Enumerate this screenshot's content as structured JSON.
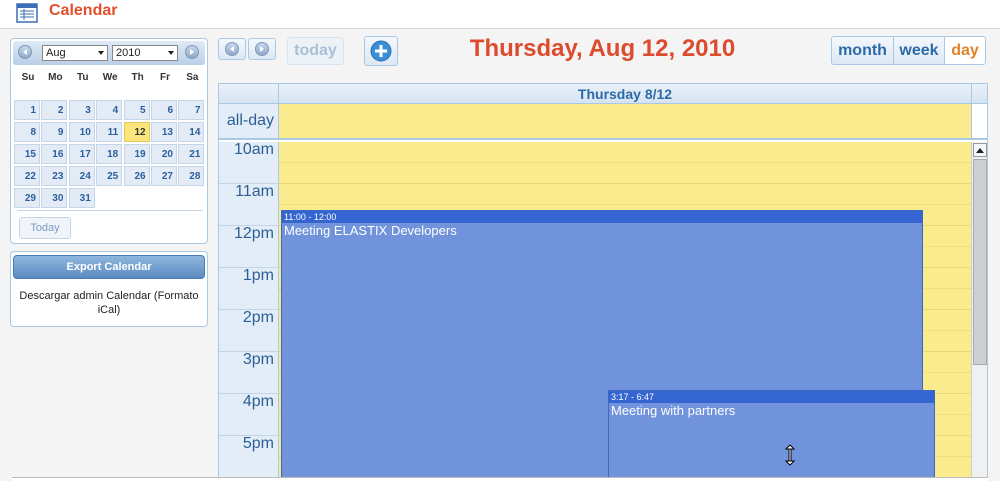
{
  "app": {
    "title": "Calendar"
  },
  "minical": {
    "month": "Aug",
    "year": "2010",
    "weekdays": [
      "Su",
      "Mo",
      "Tu",
      "We",
      "Th",
      "Fr",
      "Sa"
    ],
    "weeks": [
      [
        "1",
        "2",
        "3",
        "4",
        "5",
        "6",
        "7"
      ],
      [
        "8",
        "9",
        "10",
        "11",
        "12",
        "13",
        "14"
      ],
      [
        "15",
        "16",
        "17",
        "18",
        "19",
        "20",
        "21"
      ],
      [
        "22",
        "23",
        "24",
        "25",
        "26",
        "27",
        "28"
      ],
      [
        "29",
        "30",
        "31"
      ]
    ],
    "selected_day": "12",
    "today_label": "Today"
  },
  "export": {
    "button_label": "Export Calendar",
    "link_text": "Descargar admin Calendar (Formato iCal)"
  },
  "toolbar": {
    "today_label": "today",
    "view_title": "Thursday, Aug 12, 2010",
    "views": {
      "month": "month",
      "week": "week",
      "day": "day"
    },
    "active_view": "day"
  },
  "grid": {
    "column_header": "Thursday 8/12",
    "allday_label": "all-day",
    "hours": [
      "10am",
      "11am",
      "12pm",
      "1pm",
      "2pm",
      "3pm",
      "4pm",
      "5pm"
    ]
  },
  "events": [
    {
      "time": "11:00 - 12:00",
      "title": "Meeting ELASTIX Developers",
      "color": "#7093dc"
    },
    {
      "time": "3:17 - 6:47",
      "title": "Meeting with partners",
      "color": "#7093dc"
    }
  ],
  "colors": {
    "accent": "#dd4b2e",
    "highlight": "#faeb8e",
    "event": "#7093dc",
    "nav": "#2d6aa8"
  }
}
